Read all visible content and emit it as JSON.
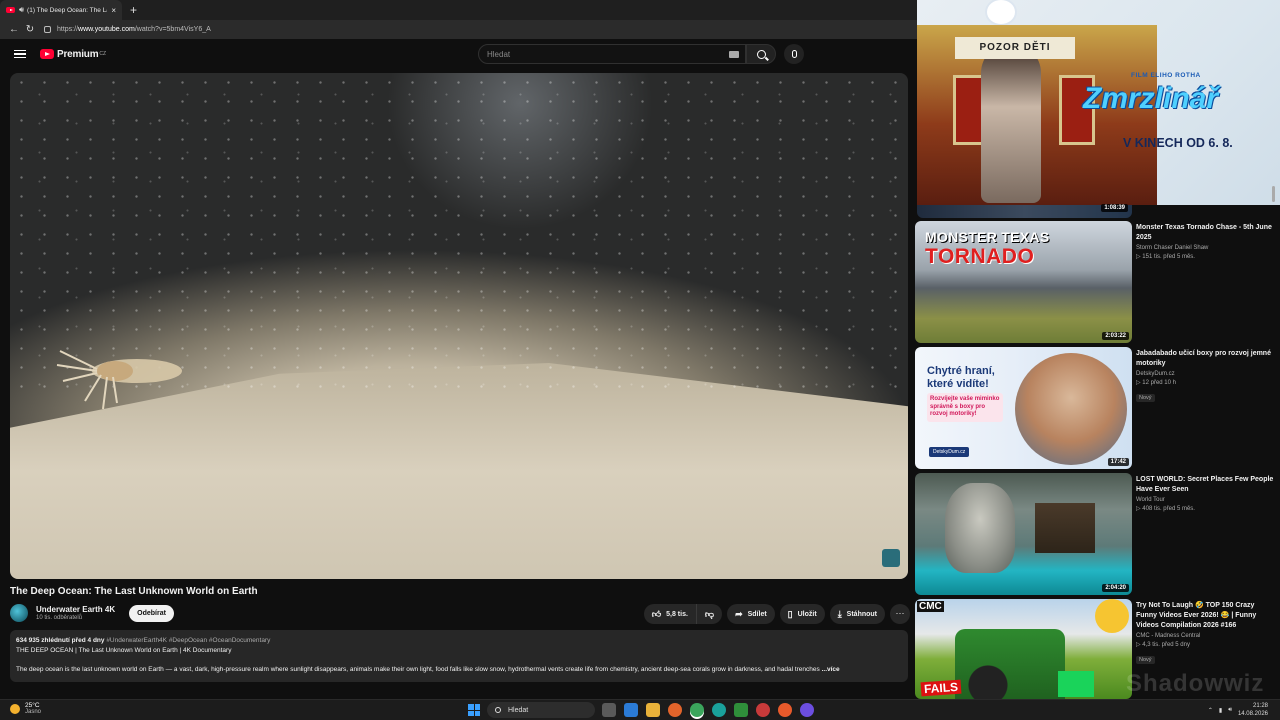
{
  "browser": {
    "tab_title": "(1) The Deep Ocean: The Last",
    "tab_close": "×",
    "new_tab": "+",
    "url_prefix": "https://",
    "url_host": "www.youtube.com",
    "url_path": "/watch?v=5bm4VisY6_A"
  },
  "header": {
    "logo_text": "Premium",
    "logo_country": "CZ",
    "search_placeholder": "Hledat"
  },
  "video": {
    "title": "The Deep Ocean: The Last Unknown World on Earth",
    "channel_name": "Underwater Earth 4K",
    "subscribers": "10 tis. odběratelů",
    "subscribe_label": "Odebírat",
    "likes": "5,8 tis.",
    "share_label": "Sdílet",
    "save_label": "Uložit",
    "download_label": "Stáhnout",
    "more_label": "···",
    "views_age": "634 935 zhlédnutí  před 4 dny",
    "hashtags": "#UnderwaterEarth4K #DeepOcean #OceanDocumentary",
    "desc_line2": "THE DEEP OCEAN | The Last Unknown World on Earth | 4K Documentary",
    "desc_line3": "The deep ocean is the last unknown world on Earth — a vast, dark, high-pressure realm where sunlight disappears, animals make their own light, food falls like slow snow, hydrothermal vents create life from chemistry, ancient deep-sea corals grow in darkness, and hadal trenches",
    "desc_more": "...více"
  },
  "ad": {
    "sign": "POZOR DĚTI",
    "film_label": "FILM ELIHO ROTHA",
    "brand": "Zmrzlinář",
    "cinema": "V KINECH OD 6. 8."
  },
  "partial_duration": "1:08:39",
  "recommendations": [
    {
      "title": "Monster Texas Tornado Chase - 5th June 2025",
      "channel": "Storm Chaser Daniel Shaw",
      "stats": "▷ 151 tis.   před 5 měs.",
      "duration": "2:03:22",
      "thumb_text_1": "MONSTER TEXAS",
      "thumb_text_2": "TORNADO"
    },
    {
      "title": "Jabadabado učicí boxy pro rozvoj jemné motoriky",
      "channel": "DetskyDum.cz",
      "stats": "▷ 12   před 10 h",
      "badge": "Nový",
      "duration": "17:42",
      "thumb_text_1": "Chytré hraní, které vidíte!",
      "thumb_text_2": "Rozvíjejte vaše miminko správně s boxy pro rozvoj motoriky!",
      "thumb_text_3": "DetskyDum.cz"
    },
    {
      "title": "LOST WORLD: Secret Places Few People Have Ever Seen",
      "channel": "World Tour",
      "stats": "▷ 408 tis.   před 5 měs.",
      "duration": "2:04:20"
    },
    {
      "title": "Try Not To Laugh 🤣 TOP 150 Crazy Funny Videos Ever 2026! 😂 | Funny Videos Compilation 2026 #166",
      "channel": "CMC - Madness Central",
      "stats": "▷ 4,3 tis.   před 5 dny",
      "badge": "Nový",
      "thumb_text_1": "CMC",
      "thumb_text_2": "FAILS"
    }
  ],
  "watermark": "Shadowwiz",
  "taskbar": {
    "temp": "25°C",
    "weather": "Jasno",
    "search_label": "Hledat",
    "time": "21:28",
    "date": "14.08.2026"
  },
  "colors": {
    "yt_red": "#ff0033",
    "background": "#0f0f0f",
    "pill": "#272727"
  }
}
